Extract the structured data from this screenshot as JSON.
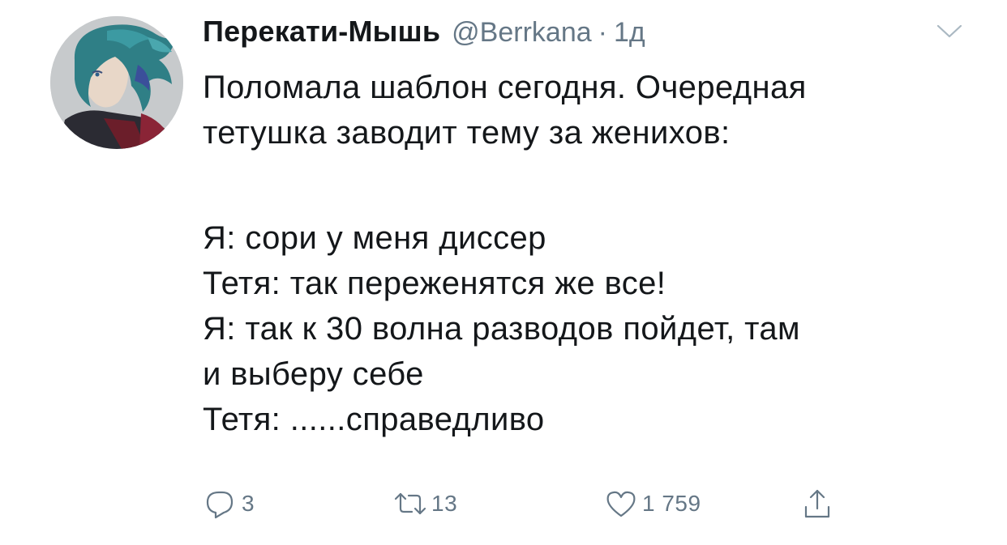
{
  "tweet": {
    "display_name": "Перекати-Мышь",
    "handle": "@Berrkana",
    "separator": "·",
    "time": "1д",
    "text_lines": [
      "Поломала шаблон сегодня. Очередная",
      "тетушка заводит тему за женихов:"
    ],
    "dialog_lines": [
      "Я: сори у меня диссер",
      "Тетя: так переженятся же все!",
      "Я: так к 30 волна разводов пойдет, там",
      "и выберу себе",
      "Тетя: ......справедливо"
    ],
    "actions": {
      "reply_count": "3",
      "retweet_count": "13",
      "like_count": "1 759"
    },
    "icons": {
      "reply": "reply-icon",
      "retweet": "retweet-icon",
      "like": "heart-icon",
      "share": "share-icon",
      "menu": "chevron-down-icon"
    },
    "colors": {
      "text": "#14171a",
      "secondary": "#657786"
    }
  }
}
